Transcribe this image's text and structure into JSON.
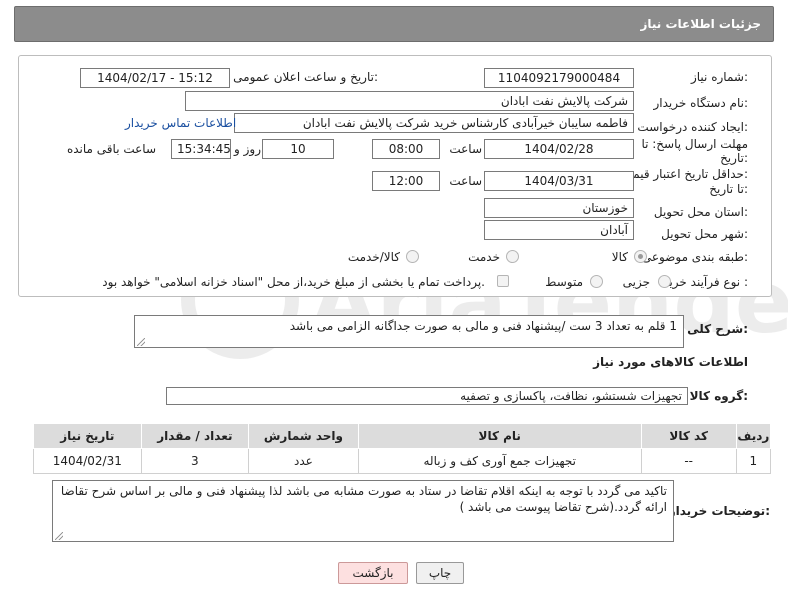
{
  "header": {
    "title": "جزئیات اطلاعات نیاز"
  },
  "fields": {
    "need_number_label": "شماره نیاز:",
    "need_number": "1104092179000484",
    "announce_label": "تاریخ و ساعت اعلان عمومی:",
    "announce_value": "1404/02/17 - 15:12",
    "buyer_label": "نام دستگاه خریدار:",
    "buyer_value": "شرکت پالایش نفت ابادان",
    "creator_label": "ایجاد کننده درخواست:",
    "creator_value": "فاطمه سایبان خیرآبادی کارشناس خرید شرکت پالایش نفت ابادان",
    "contact_link": "اطلاعات تماس خریدار",
    "deadline_label_1": "مهلت ارسال پاسخ: تا",
    "deadline_label_2": "تاریخ:",
    "deadline_date": "1404/02/28",
    "time_label": "ساعت",
    "deadline_time": "08:00",
    "days_value": "10",
    "days_label": "روز و",
    "remaining_time": "15:34:45",
    "remaining_label": "ساعت باقی مانده",
    "validity_label_1": "حداقل تاریخ اعتبار قیمت:",
    "validity_label_2": "تا تاریخ:",
    "validity_date": "1404/03/31",
    "validity_time": "12:00",
    "province_label": "استان محل تحویل:",
    "province_value": "خوزستان",
    "city_label": "شهر محل تحویل:",
    "city_value": "آبادان",
    "category_label": "طبقه بندی موضوعی:",
    "category_options": [
      "کالا",
      "خدمت",
      "کالا/خدمت"
    ],
    "process_label": "نوع فرآیند خرید :",
    "process_options": [
      "جزیی",
      "متوسط"
    ],
    "payment_note": "پرداخت تمام یا بخشی از مبلغ خرید،از محل \"اسناد خزانه اسلامی\" خواهد بود."
  },
  "description": {
    "label": "شرح کلی نیاز:",
    "text": "1 قلم به تعداد 3 ست /پیشنهاد فنی و مالی به صورت جداگانه الزامی می باشد"
  },
  "goods": {
    "section_title": "اطلاعات کالاهای مورد نیاز",
    "group_label": "گروه کالا:",
    "group_value": "تجهیزات شستشو، نظافت، پاکسازی و تصفیه",
    "headers": [
      "ردیف",
      "کد کالا",
      "نام کالا",
      "واحد شمارش",
      "تعداد / مقدار",
      "تاریخ نیاز"
    ],
    "rows": [
      [
        "1",
        "--",
        "تجهیزات جمع آوری کف و زباله",
        "عدد",
        "3",
        "1404/02/31"
      ]
    ]
  },
  "notes": {
    "label": "توضیحات خریدار:",
    "text": "تاکید می گردد با توجه به اینکه اقلام تقاضا در ستاد به  صورت مشابه می باشد لذا پیشنهاد فنی و مالی بر اساس شرح تقاضا ارائه گردد.(شرح تقاضا پیوست می باشد )"
  },
  "buttons": {
    "print": "چاپ",
    "back": "بازگشت"
  },
  "watermark": {
    "text": "AriaTender.net"
  }
}
